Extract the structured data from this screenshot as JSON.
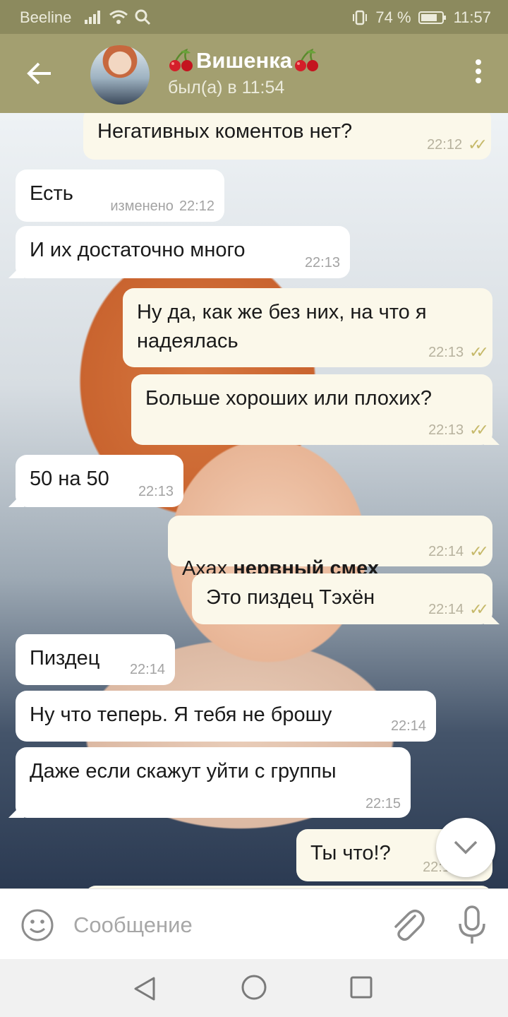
{
  "status_bar": {
    "carrier": "Beeline",
    "battery": "74 %",
    "time": "11:57"
  },
  "header": {
    "title": "Вишенка",
    "status": "был(а) в 11:54"
  },
  "messages": [
    {
      "text": "Негативных коментов нет?",
      "time": "22:12",
      "dir": "out"
    },
    {
      "text": "Есть",
      "edited": "изменено",
      "time": "22:12",
      "dir": "in"
    },
    {
      "text": "И их достаточно много",
      "time": "22:13",
      "dir": "in"
    },
    {
      "text": "Ну да, как же без них, на что я\nнадеялась",
      "time": "22:13",
      "dir": "out"
    },
    {
      "text": "Больше хороших или плохих?",
      "time": "22:13",
      "dir": "out"
    },
    {
      "text": "50 на 50",
      "time": "22:13",
      "dir": "in"
    },
    {
      "text": "Ахах ",
      "bold": "нервный смех",
      "time": "22:14",
      "dir": "out"
    },
    {
      "text": "Это пиздец Тэхён",
      "time": "22:14",
      "dir": "out"
    },
    {
      "text": "Пиздец",
      "time": "22:14",
      "dir": "in"
    },
    {
      "text": "Ну что теперь. Я тебя не брошу",
      "time": "22:14",
      "dir": "in"
    },
    {
      "text": "Даже если скажут уйти с группы",
      "time": "22:15",
      "dir": "in"
    },
    {
      "text": "Ты что!?",
      "time": "22:1",
      "dir": "out"
    }
  ],
  "composer": {
    "placeholder": "Сообщение"
  },
  "colors": {
    "header": "#a39f70",
    "status_bar": "#8c8a5e",
    "incoming_bubble": "#ffffff",
    "outgoing_bubble": "#fbf8ea",
    "read_ticks": "#c6b96a"
  }
}
